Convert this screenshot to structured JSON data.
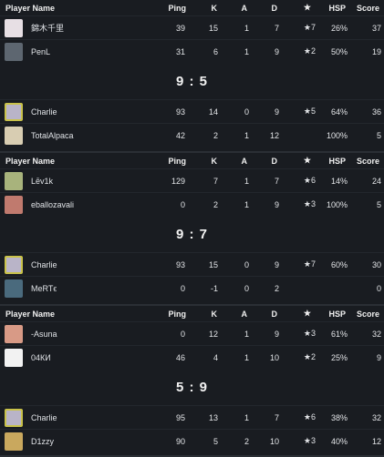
{
  "headers": {
    "player": "Player Name",
    "ping": "Ping",
    "k": "K",
    "a": "A",
    "d": "D",
    "star": "★",
    "hsp": "HSP",
    "score": "Score"
  },
  "matches": [
    {
      "show_header": false,
      "team1": [
        {
          "name": "錦木千里",
          "avatar": "#e7dfe4",
          "ping": "39",
          "k": "15",
          "a": "1",
          "d": "7",
          "star": "★7",
          "hsp": "26%",
          "score": "37"
        },
        {
          "name": "PenL",
          "avatar": "#5d6670",
          "ping": "31",
          "k": "6",
          "a": "1",
          "d": "9",
          "star": "★2",
          "hsp": "50%",
          "score": "19"
        }
      ],
      "score": "9 : 5",
      "team2": [
        {
          "name": "Charlie",
          "avatar": "#b9b4c8",
          "ping": "93",
          "k": "14",
          "a": "0",
          "d": "9",
          "star": "★5",
          "hsp": "64%",
          "score": "36"
        },
        {
          "name": "TotalAlpaca",
          "avatar": "#d8cdb2",
          "ping": "42",
          "k": "2",
          "a": "1",
          "d": "12",
          "star": "",
          "hsp": "100%",
          "score": "5"
        }
      ]
    },
    {
      "show_header": true,
      "team1": [
        {
          "name": "Lēv1k",
          "avatar": "#a8b37c",
          "ping": "129",
          "k": "7",
          "a": "1",
          "d": "7",
          "star": "★6",
          "hsp": "14%",
          "score": "24"
        },
        {
          "name": "eballozavali",
          "avatar": "#c07a6e",
          "ping": "0",
          "k": "2",
          "a": "1",
          "d": "9",
          "star": "★3",
          "hsp": "100%",
          "score": "5"
        }
      ],
      "score": "9 : 7",
      "team2": [
        {
          "name": "Charlie",
          "avatar": "#b9b4c8",
          "ping": "93",
          "k": "15",
          "a": "0",
          "d": "9",
          "star": "★7",
          "hsp": "60%",
          "score": "30"
        },
        {
          "name": "MeRTϵ",
          "avatar": "#4a6a7d",
          "ping": "0",
          "k": "-1",
          "a": "0",
          "d": "2",
          "star": "",
          "hsp": "",
          "score": "0"
        }
      ]
    },
    {
      "show_header": true,
      "team1": [
        {
          "name": "-Asuna",
          "avatar": "#d89a86",
          "ping": "0",
          "k": "12",
          "a": "1",
          "d": "9",
          "star": "★3",
          "hsp": "61%",
          "score": "32"
        },
        {
          "name": "04КИ",
          "avatar": "#f2f2f2",
          "ping": "46",
          "k": "4",
          "a": "1",
          "d": "10",
          "star": "★2",
          "hsp": "25%",
          "score": "9"
        }
      ],
      "score": "5 : 9",
      "team2": [
        {
          "name": "Charlie",
          "avatar": "#b9b4c8",
          "ping": "95",
          "k": "13",
          "a": "1",
          "d": "7",
          "star": "★6",
          "hsp": "38%",
          "score": "32"
        },
        {
          "name": "D1zzy",
          "avatar": "#c9a85e",
          "ping": "90",
          "k": "5",
          "a": "2",
          "d": "10",
          "star": "★3",
          "hsp": "40%",
          "score": "12"
        }
      ]
    }
  ],
  "colors": {
    "background": "#191c21",
    "row_border": "#23272d",
    "highlight_avatar_border": "#c9c24a"
  }
}
